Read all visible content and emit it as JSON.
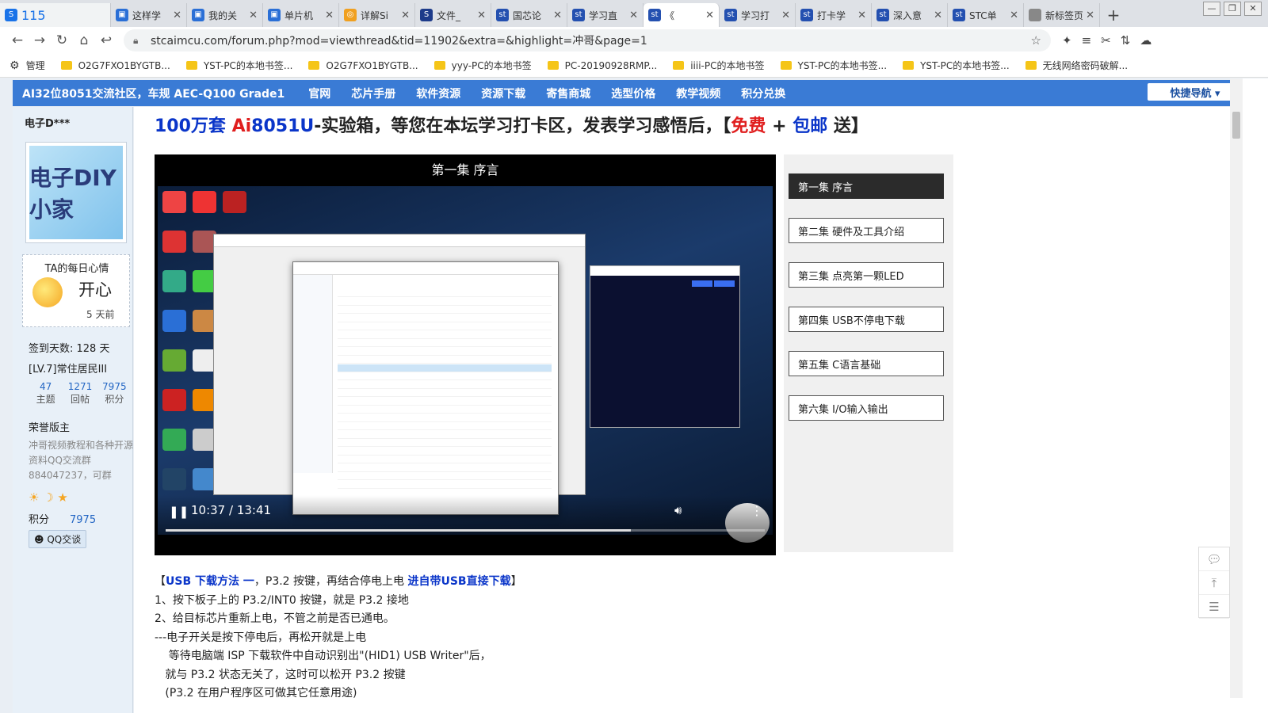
{
  "browser": {
    "tabs": [
      {
        "label": "115",
        "color": "#1a73e8",
        "icon": "S"
      },
      {
        "label": "这样学",
        "color": "#2a6fd6",
        "icon": "▣"
      },
      {
        "label": "我的关",
        "color": "#2a6fd6",
        "icon": "▣"
      },
      {
        "label": "单片机",
        "color": "#2a6fd6",
        "icon": "▣"
      },
      {
        "label": "详解Si",
        "color": "#f0a020",
        "icon": "◎"
      },
      {
        "label": "文件_",
        "color": "#1d3b8a",
        "icon": "S"
      },
      {
        "label": "国芯论",
        "color": "#2450b0",
        "icon": "st"
      },
      {
        "label": "学习直",
        "color": "#2450b0",
        "icon": "st"
      },
      {
        "label": "《",
        "color": "#2450b0",
        "icon": "st"
      },
      {
        "label": "学习打",
        "color": "#2450b0",
        "icon": "st"
      },
      {
        "label": "打卡学",
        "color": "#2450b0",
        "icon": "st"
      },
      {
        "label": "深入意",
        "color": "#2450b0",
        "icon": "st"
      },
      {
        "label": "STC单",
        "color": "#2450b0",
        "icon": "st"
      },
      {
        "label": "新标签页",
        "color": "#888888",
        "icon": ""
      }
    ],
    "active_tab_index": 8,
    "url": "stcaimcu.com/forum.php?mod=viewthread&tid=11902&extra=&highlight=冲哥&page=1",
    "bookmarks": [
      "管理",
      "O2G7FXO1BYGTB...",
      "YST-PC的本地书签...",
      "O2G7FXO1BYGTB...",
      "yyy-PC的本地书签",
      "PC-20190928RMP...",
      "iiii-PC的本地书签",
      "YST-PC的本地书签...",
      "YST-PC的本地书签...",
      "无线网络密码破解..."
    ]
  },
  "site": {
    "brand": "AI32位8051交流社区，车规 AEC-Q100 Grade1",
    "nav": [
      "官网",
      "芯片手册",
      "软件资源",
      "资源下载",
      "寄售商城",
      "选型价格",
      "教学视频",
      "积分兑换"
    ],
    "quicknav": "快捷导航 ▾"
  },
  "user": {
    "name": "电子D***",
    "avatar_text": "电子DIY小家",
    "mood_title": "TA的每日心情",
    "mood_value": "开心",
    "mood_date": "5 天前",
    "signin": "签到天数: 128 天",
    "level": "[LV.7]常住居民III",
    "stats": [
      {
        "value": "47",
        "label": "主题"
      },
      {
        "value": "1271",
        "label": "回帖"
      },
      {
        "value": "7975",
        "label": "积分"
      }
    ],
    "honor": "荣誉版主",
    "honor_desc": "冲哥视频教程和各种开源资料QQ交流群884047237，可群",
    "score_label": "积分",
    "score_value": "7975",
    "qq_label": "QQ交谈"
  },
  "post": {
    "headline_parts": [
      "100万套 ",
      "Ai",
      "8051U",
      "-实验箱，等您在本坛学习打卡区，发表学习感悟后，【",
      "免费",
      " + ",
      "包邮",
      " 送】"
    ],
    "video": {
      "title": "第一集 序言",
      "time": "10:37 / 13:41",
      "progress": 0.776
    },
    "playlist": [
      "第一集 序言",
      "第二集 硬件及工具介绍",
      "第三集 点亮第一颗LED",
      "第四集 USB不停电下载",
      "第五集 C语言基础",
      "第六集 I/O输入输出"
    ],
    "article": {
      "line1_bracket_open": "【",
      "line1_b1": "USB 下载方法 一",
      "line1_mid": "，P3.2 按键，再结合停电上电 ",
      "line1_b2": "进自带USB直接下载",
      "line1_bracket_close": "】",
      "line2": "1、按下板子上的 P3.2/INT0 按键，就是 P3.2 接地",
      "line3": "2、给目标芯片重新上电，不管之前是否已通电。",
      "line4": "---电子开关是按下停电后，再松开就是上电",
      "line5": "    等待电脑端 ISP 下载软件中自动识别出\"(HID1) USB Writer\"后，",
      "line6": "   就与 P3.2 状态无关了，这时可以松开 P3.2 按键",
      "line7": "   (P3.2 在用户程序区可做其它任意用途)"
    }
  }
}
